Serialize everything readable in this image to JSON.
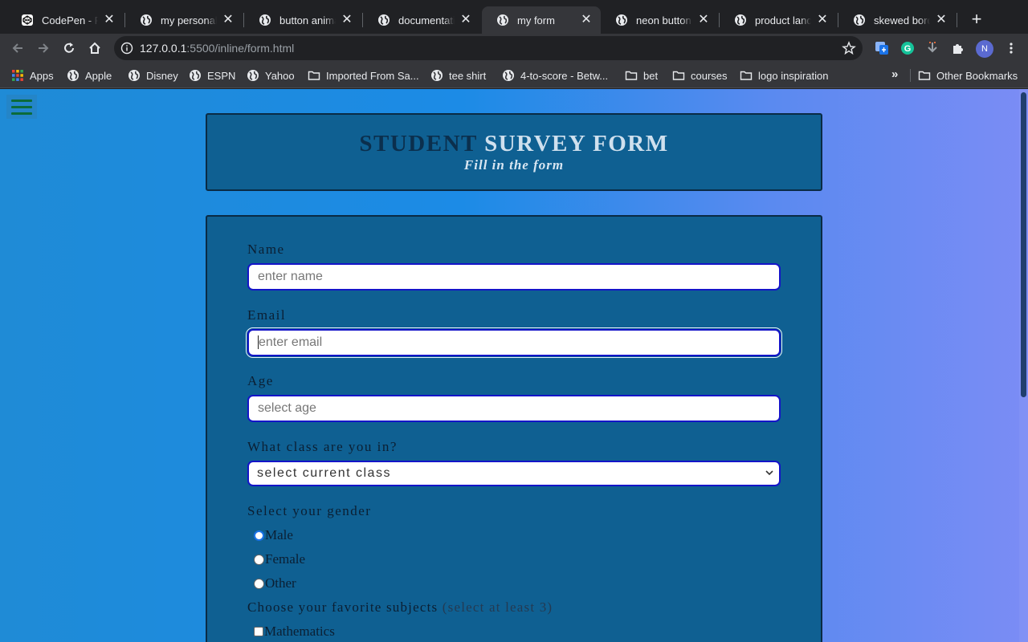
{
  "browser": {
    "tabs": [
      {
        "title": "CodePen - FCC",
        "active": false
      },
      {
        "title": "my personal portfolio",
        "active": false
      },
      {
        "title": "button animation",
        "active": false
      },
      {
        "title": "documentation",
        "active": false
      },
      {
        "title": "my form",
        "active": true
      },
      {
        "title": "neon button",
        "active": false
      },
      {
        "title": "product landing",
        "active": false
      },
      {
        "title": "skewed border",
        "active": false
      }
    ],
    "close_glyph": "✕",
    "newtab_glyph": "+",
    "url_host": "127.0.0.1",
    "url_rest": ":5500/inline/form.html",
    "profile_initial": "N",
    "bookmarks": [
      {
        "label": "Apps",
        "icon": "apps-grid-icon"
      },
      {
        "label": "Apple",
        "icon": "globe-icon"
      },
      {
        "label": "Disney",
        "icon": "globe-icon"
      },
      {
        "label": "ESPN",
        "icon": "globe-icon"
      },
      {
        "label": "Yahoo",
        "icon": "globe-icon"
      },
      {
        "label": "Imported From Sa...",
        "icon": "folder-icon"
      },
      {
        "label": "tee shirt",
        "icon": "globe-icon"
      },
      {
        "label": "4-to-score - Betw...",
        "icon": "globe-icon"
      },
      {
        "label": "bet",
        "icon": "folder-icon"
      },
      {
        "label": "courses",
        "icon": "folder-icon"
      },
      {
        "label": "logo inspiration",
        "icon": "folder-icon"
      }
    ],
    "overflow_chevron": "»",
    "other_bookmarks": "Other Bookmarks"
  },
  "page": {
    "header": {
      "title_part1": "STUDENT",
      "title_part2": "SURVEY FORM",
      "subtitle": "Fill in the form"
    },
    "form": {
      "name_label": "Name",
      "name_placeholder": "enter name",
      "email_label": "Email",
      "email_placeholder": "enter email",
      "age_label": "Age",
      "age_placeholder": "select age",
      "class_label": "What class are you in?",
      "class_selected": "select current class",
      "gender_label": "Select your gender",
      "gender_options": [
        "Male",
        "Female",
        "Other"
      ],
      "gender_checked": "Male",
      "subjects_label": "Choose your favorite subjects",
      "subjects_hint": "(select at least 3)",
      "subjects_options": [
        "Mathematics"
      ]
    }
  },
  "colors": {
    "page_gradient_start": "#1f8bd6",
    "page_gradient_end": "#7b8cf5",
    "card_bg": "#0f6092",
    "field_border": "#1414c8",
    "hamburger": "#0b6b3a"
  }
}
